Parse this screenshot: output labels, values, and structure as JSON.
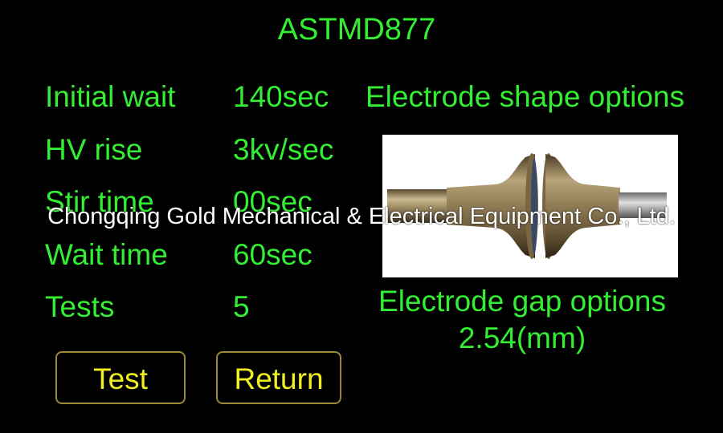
{
  "screen": {
    "title": "ASTMD877",
    "background_color": "#000000",
    "text_color": "#33ee33",
    "button_text_color": "#f0f020"
  },
  "params": [
    {
      "label": "Initial wait",
      "value": "140sec"
    },
    {
      "label": "HV rise",
      "value": "3kv/sec"
    },
    {
      "label": "Stir time",
      "value": "00sec"
    },
    {
      "label": "Wait time",
      "value": "60sec"
    },
    {
      "label": "Tests",
      "value": "5"
    }
  ],
  "electrode": {
    "shape_heading": "Electrode shape options",
    "image_semantic": "mushroom-electrode-pair-photo",
    "gap_heading": "Electrode gap options",
    "gap_value": "2.54(mm)"
  },
  "buttons": {
    "test_label": "Test",
    "return_label": "Return"
  },
  "watermark": {
    "text": "Chongqing Gold Mechanical & Electrical Equipment Co., Ltd."
  }
}
